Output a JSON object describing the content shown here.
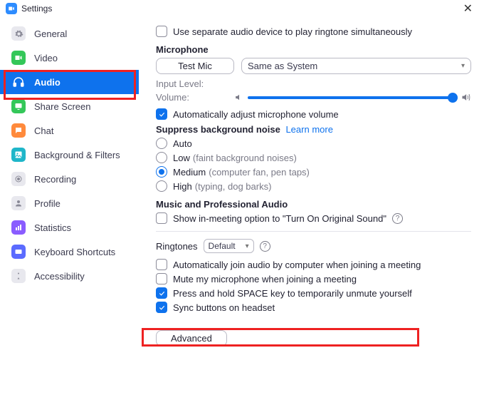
{
  "window": {
    "title": "Settings"
  },
  "sidebar": {
    "items": [
      {
        "label": "General"
      },
      {
        "label": "Video"
      },
      {
        "label": "Audio"
      },
      {
        "label": "Share Screen"
      },
      {
        "label": "Chat"
      },
      {
        "label": "Background & Filters"
      },
      {
        "label": "Recording"
      },
      {
        "label": "Profile"
      },
      {
        "label": "Statistics"
      },
      {
        "label": "Keyboard Shortcuts"
      },
      {
        "label": "Accessibility"
      }
    ]
  },
  "audio": {
    "separate_device": "Use separate audio device to play ringtone simultaneously",
    "mic_header": "Microphone",
    "test_mic": "Test Mic",
    "mic_device": "Same as System",
    "input_level": "Input Level:",
    "volume": "Volume:",
    "auto_adjust": "Automatically adjust microphone volume",
    "suppress_header": "Suppress background noise",
    "learn_more": "Learn more",
    "suppress": {
      "auto": "Auto",
      "low": "Low",
      "low_hint": "(faint background noises)",
      "medium": "Medium",
      "medium_hint": "(computer fan, pen taps)",
      "high": "High",
      "high_hint": "(typing, dog barks)"
    },
    "music_header": "Music and Professional Audio",
    "original_sound": "Show in-meeting option to \"Turn On Original Sound\"",
    "ringtones_label": "Ringtones",
    "ringtones_value": "Default",
    "auto_join": "Automatically join audio by computer when joining a meeting",
    "mute_on_join": "Mute my microphone when joining a meeting",
    "space_unmute": "Press and hold SPACE key to temporarily unmute yourself",
    "sync_headset": "Sync buttons on headset",
    "advanced": "Advanced"
  }
}
